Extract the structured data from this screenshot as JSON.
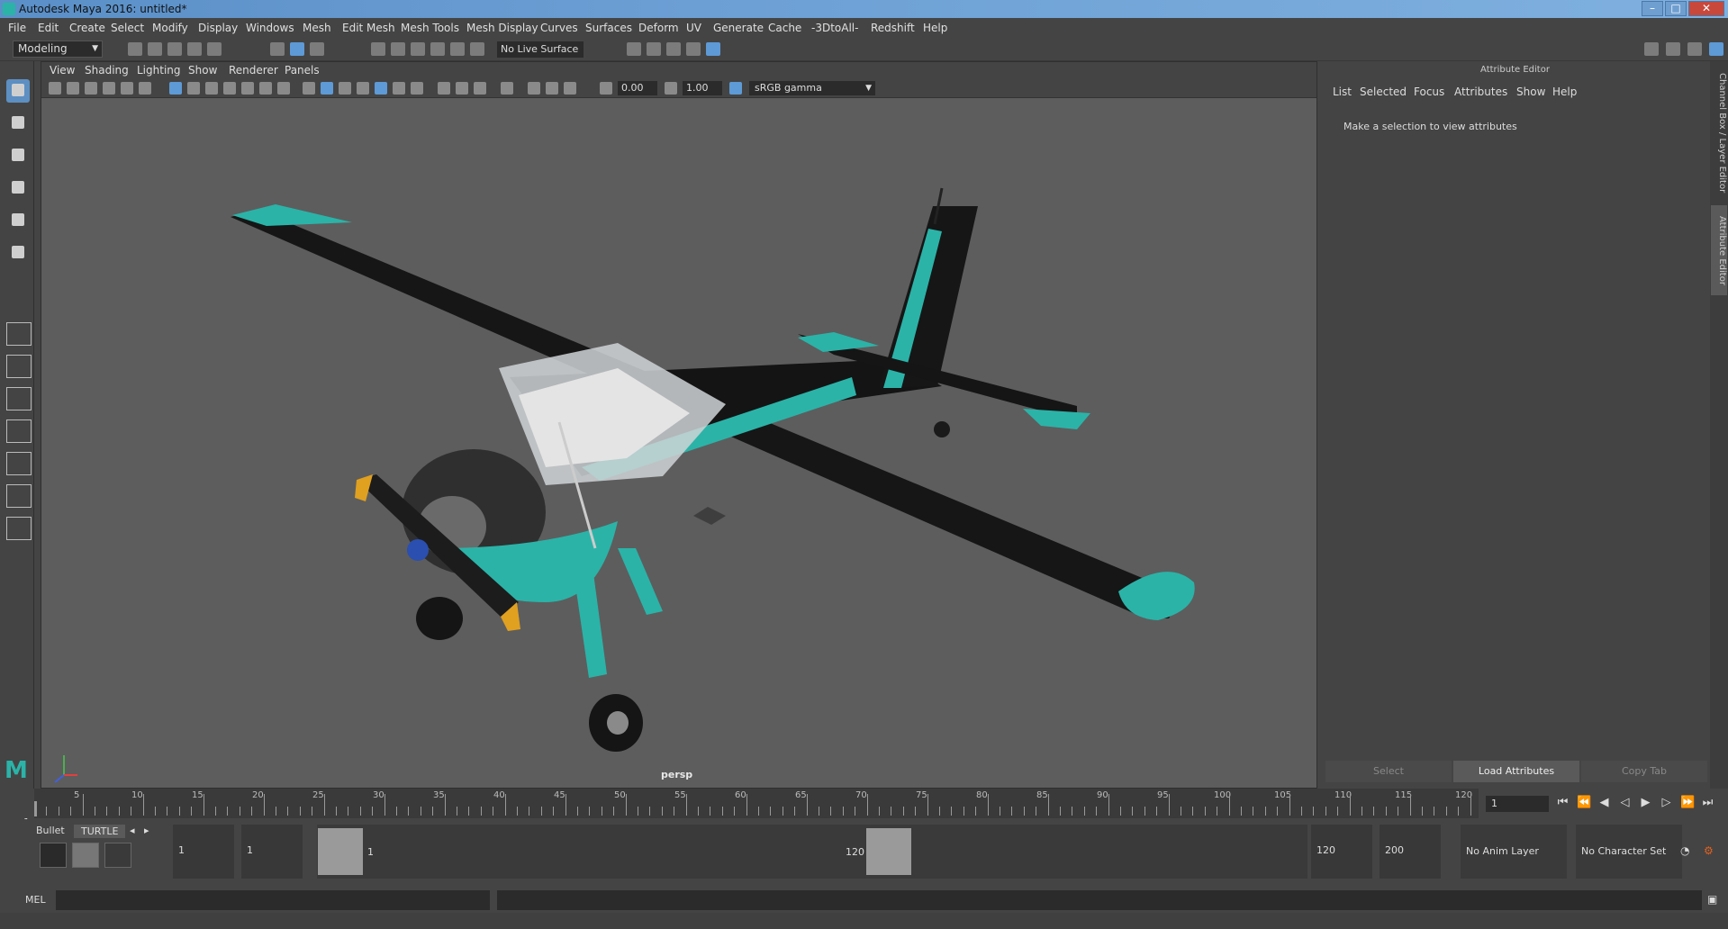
{
  "window": {
    "title": "Autodesk Maya 2016: untitled*",
    "min": "–",
    "max": "□",
    "close": "✕"
  },
  "menubar": [
    "File",
    "Edit",
    "Create",
    "Select",
    "Modify",
    "Display",
    "Windows",
    "Mesh",
    "Edit Mesh",
    "Mesh Tools",
    "Mesh Display",
    "Curves",
    "Surfaces",
    "Deform",
    "UV",
    "Generate",
    "Cache",
    "-3DtoAll-",
    "Redshift",
    "Help"
  ],
  "toolbar": {
    "mode": "Modeling",
    "live_surface": "No Live Surface"
  },
  "viewport": {
    "menu": [
      "View",
      "Shading",
      "Lighting",
      "Show",
      "Renderer",
      "Panels"
    ],
    "field_a": "0.00",
    "field_b": "1.00",
    "color_space": "sRGB gamma",
    "camera": "persp"
  },
  "attribute_editor": {
    "title": "Attribute Editor",
    "menu": [
      "List",
      "Selected",
      "Focus",
      "Attributes",
      "Show",
      "Help"
    ],
    "message": "Make a selection to view attributes",
    "buttons": {
      "select": "Select",
      "load": "Load Attributes",
      "copy": "Copy Tab"
    }
  },
  "side_tabs": {
    "channel_box": "Channel Box / Layer Editor",
    "attribute_editor": "Attribute Editor"
  },
  "timeline": {
    "ticks": [
      "5",
      "10",
      "15",
      "20",
      "25",
      "30",
      "35",
      "40",
      "45",
      "50",
      "55",
      "60",
      "65",
      "70",
      "75",
      "80",
      "85",
      "90",
      "95",
      "100",
      "105",
      "110",
      "115",
      "120"
    ],
    "current_label": "1",
    "current_frame": "1"
  },
  "shelf": {
    "tabs": {
      "bullet": "Bullet",
      "turtle": "TURTLE"
    },
    "start_a": "1",
    "start_b": "1",
    "range_start": "1",
    "range_end": "120",
    "end_a": "120",
    "end_b": "200",
    "anim_layer": "No Anim Layer",
    "char_set": "No Character Set"
  },
  "cmdline": {
    "label": "MEL"
  },
  "colors": {
    "accent_teal": "#2bb3a8",
    "plane_body": "#1a1a1a",
    "viewport_bg": "#5d5d5d",
    "select_blue": "#5d8fc2"
  }
}
